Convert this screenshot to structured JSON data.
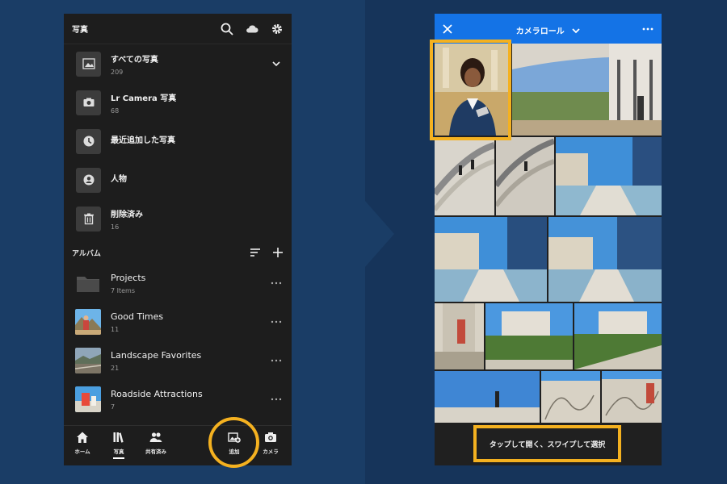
{
  "left": {
    "header": {
      "title": "写真"
    },
    "library": [
      {
        "label": "すべての写真",
        "count": "209",
        "icon": "image-icon"
      },
      {
        "label": "Lr Camera 写真",
        "count": "68",
        "icon": "camera-icon"
      },
      {
        "label": "最近追加した写真",
        "count": "",
        "icon": "clock-icon"
      },
      {
        "label": "人物",
        "count": "",
        "icon": "person-icon"
      },
      {
        "label": "削除済み",
        "count": "16",
        "icon": "trash-icon"
      }
    ],
    "albums_title": "アルバム",
    "albums": [
      {
        "label": "Projects",
        "count": "7 Items"
      },
      {
        "label": "Good Times",
        "count": "11"
      },
      {
        "label": "Landscape Favorites",
        "count": "21"
      },
      {
        "label": "Roadside Attractions",
        "count": "7"
      }
    ],
    "tabs": {
      "home": "ホーム",
      "photos": "写真",
      "shared": "共有済み",
      "add": "追加",
      "camera": "カメラ"
    }
  },
  "right": {
    "header": {
      "title": "カメラロール"
    },
    "hint": "タップして開く、スワイプして選択"
  },
  "colors": {
    "accent_blue": "#1473e6",
    "highlight": "#f4b120",
    "background": "#17345a"
  }
}
